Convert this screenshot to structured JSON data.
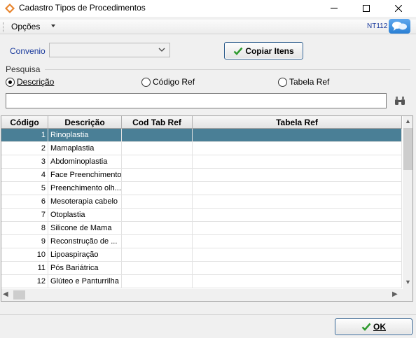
{
  "window": {
    "title": "Cadastro Tipos de Procedimentos",
    "minimize_glyph": "—",
    "maximize_glyph": "☐",
    "close_glyph": "✕"
  },
  "menubar": {
    "opcoes_label": "Opções",
    "nt_label": "NT112"
  },
  "convenio": {
    "label": "Convenio",
    "value": ""
  },
  "copiar_button": {
    "label": "Copiar Itens"
  },
  "pesquisa": {
    "label": "Pesquisa",
    "options": [
      {
        "label": "Descrição",
        "selected": true
      },
      {
        "label": "Código Ref",
        "selected": false
      },
      {
        "label": "Tabela Ref",
        "selected": false
      }
    ],
    "search_value": ""
  },
  "table": {
    "columns": [
      "Código",
      "Descrição",
      "Cod Tab Ref",
      "Tabela Ref"
    ],
    "rows": [
      {
        "codigo": "1",
        "descricao": "Rinoplastia",
        "cod_tab_ref": "",
        "tabela_ref": ""
      },
      {
        "codigo": "2",
        "descricao": "Mamaplastia",
        "cod_tab_ref": "",
        "tabela_ref": ""
      },
      {
        "codigo": "3",
        "descricao": "Abdominoplastia",
        "cod_tab_ref": "",
        "tabela_ref": ""
      },
      {
        "codigo": "4",
        "descricao": "Face Preenchimento",
        "cod_tab_ref": "",
        "tabela_ref": ""
      },
      {
        "codigo": "5",
        "descricao": "Preenchimento olh...",
        "cod_tab_ref": "",
        "tabela_ref": ""
      },
      {
        "codigo": "6",
        "descricao": "Mesoterapia cabelo",
        "cod_tab_ref": "",
        "tabela_ref": ""
      },
      {
        "codigo": "7",
        "descricao": "Otoplastia",
        "cod_tab_ref": "",
        "tabela_ref": ""
      },
      {
        "codigo": "8",
        "descricao": "Silicone de Mama",
        "cod_tab_ref": "",
        "tabela_ref": ""
      },
      {
        "codigo": "9",
        "descricao": "Reconstrução de ...",
        "cod_tab_ref": "",
        "tabela_ref": ""
      },
      {
        "codigo": "10",
        "descricao": "Lipoaspiração",
        "cod_tab_ref": "",
        "tabela_ref": ""
      },
      {
        "codigo": "11",
        "descricao": "Pós Bariátrica",
        "cod_tab_ref": "",
        "tabela_ref": ""
      },
      {
        "codigo": "12",
        "descricao": "Glúteo e Panturrilha",
        "cod_tab_ref": "",
        "tabela_ref": ""
      }
    ],
    "selected_row": 0
  },
  "ok_button": {
    "label": "OK"
  },
  "colors": {
    "selected_row": "#4a7f96",
    "label_blue": "#1a3a9c",
    "check_green": "#2e9a2e"
  }
}
